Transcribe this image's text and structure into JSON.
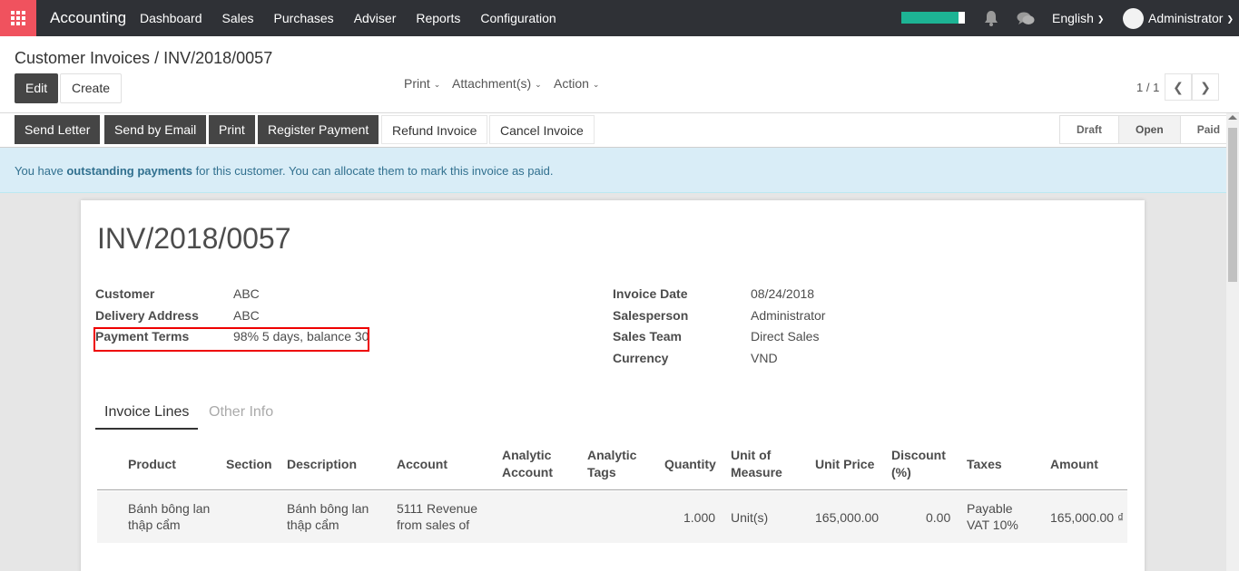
{
  "nav": {
    "brand": "Accounting",
    "menu": [
      "Dashboard",
      "Sales",
      "Purchases",
      "Adviser",
      "Reports",
      "Configuration"
    ],
    "language": "English",
    "user": "Administrator",
    "progress_fraction": 0.9,
    "accent_color": "#f0525e"
  },
  "control": {
    "breadcrumb_parent": "Customer Invoices",
    "breadcrumb_separator": "/",
    "breadcrumb_current": "INV/2018/0057",
    "edit_label": "Edit",
    "create_label": "Create",
    "print_label": "Print",
    "attachments_label": "Attachment(s)",
    "action_label": "Action",
    "pager": "1 / 1"
  },
  "statusbar": {
    "buttons": [
      "Send Letter",
      "Send by Email",
      "Print",
      "Register Payment",
      "Refund Invoice",
      "Cancel Invoice"
    ],
    "stages": [
      "Draft",
      "Open",
      "Paid"
    ],
    "active_stage": "Open"
  },
  "alert": {
    "prefix": "You have ",
    "strong": "outstanding payments",
    "suffix": " for this customer. You can allocate them to mark this invoice as paid."
  },
  "invoice": {
    "title": "INV/2018/0057",
    "left_fields": [
      {
        "label": "Customer",
        "value": "ABC"
      },
      {
        "label": "Delivery Address",
        "value": "ABC"
      },
      {
        "label": "Payment Terms",
        "value": "98% 5 days, balance 30"
      }
    ],
    "right_fields": [
      {
        "label": "Invoice Date",
        "value": "08/24/2018"
      },
      {
        "label": "Salesperson",
        "value": "Administrator"
      },
      {
        "label": "Sales Team",
        "value": "Direct Sales"
      },
      {
        "label": "Currency",
        "value": "VND"
      }
    ]
  },
  "tabs": [
    "Invoice Lines",
    "Other Info"
  ],
  "table": {
    "headers": [
      "Product",
      "Section",
      "Description",
      "Account",
      "Analytic Account",
      "Analytic Tags",
      "Quantity",
      "Unit of Measure",
      "Unit Price",
      "Discount (%)",
      "Taxes",
      "Amount"
    ],
    "rows": [
      {
        "product": "Bánh bông lan thập cẩm",
        "section": "",
        "description": "Bánh bông lan thập cẩm",
        "account": "5111 Revenue from sales of",
        "analytic_account": "",
        "analytic_tags": "",
        "quantity": "1.000",
        "uom": "Unit(s)",
        "unit_price": "165,000.00",
        "discount": "0.00",
        "taxes": "Payable VAT 10%",
        "amount": "165,000.00 ₫"
      }
    ]
  }
}
